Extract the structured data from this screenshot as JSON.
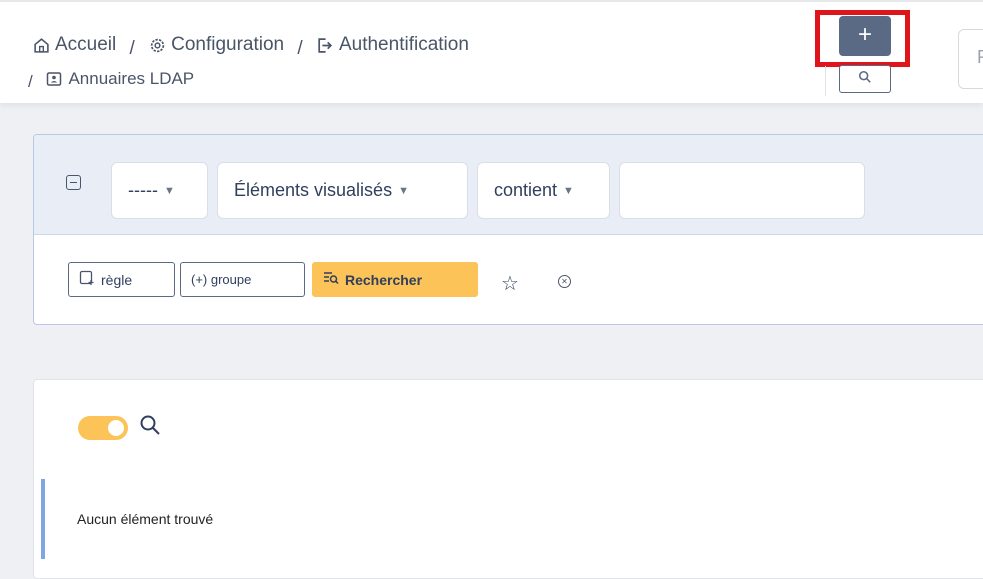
{
  "breadcrumb": {
    "items": [
      {
        "label": "Accueil",
        "icon": "home-icon"
      },
      {
        "label": "Configuration",
        "icon": "gear-icon"
      },
      {
        "label": "Authentification",
        "icon": "sign-in-icon"
      },
      {
        "label": "Annuaires LDAP",
        "icon": "address-card-icon"
      }
    ],
    "separator": "/"
  },
  "toolbar": {
    "add_label": "+",
    "right_input_placeholder": "R"
  },
  "filter": {
    "field_select": "-----",
    "criteria_select": "Éléments visualisés",
    "operator_select": "contient",
    "value": "",
    "rule_label": "règle",
    "group_label": "(+) groupe",
    "search_label": "Rechercher"
  },
  "list": {
    "empty_message": "Aucun élément trouvé"
  },
  "colors": {
    "accent": "#fbc358",
    "highlight": "#e0141b",
    "primary": "#5a6a85"
  }
}
